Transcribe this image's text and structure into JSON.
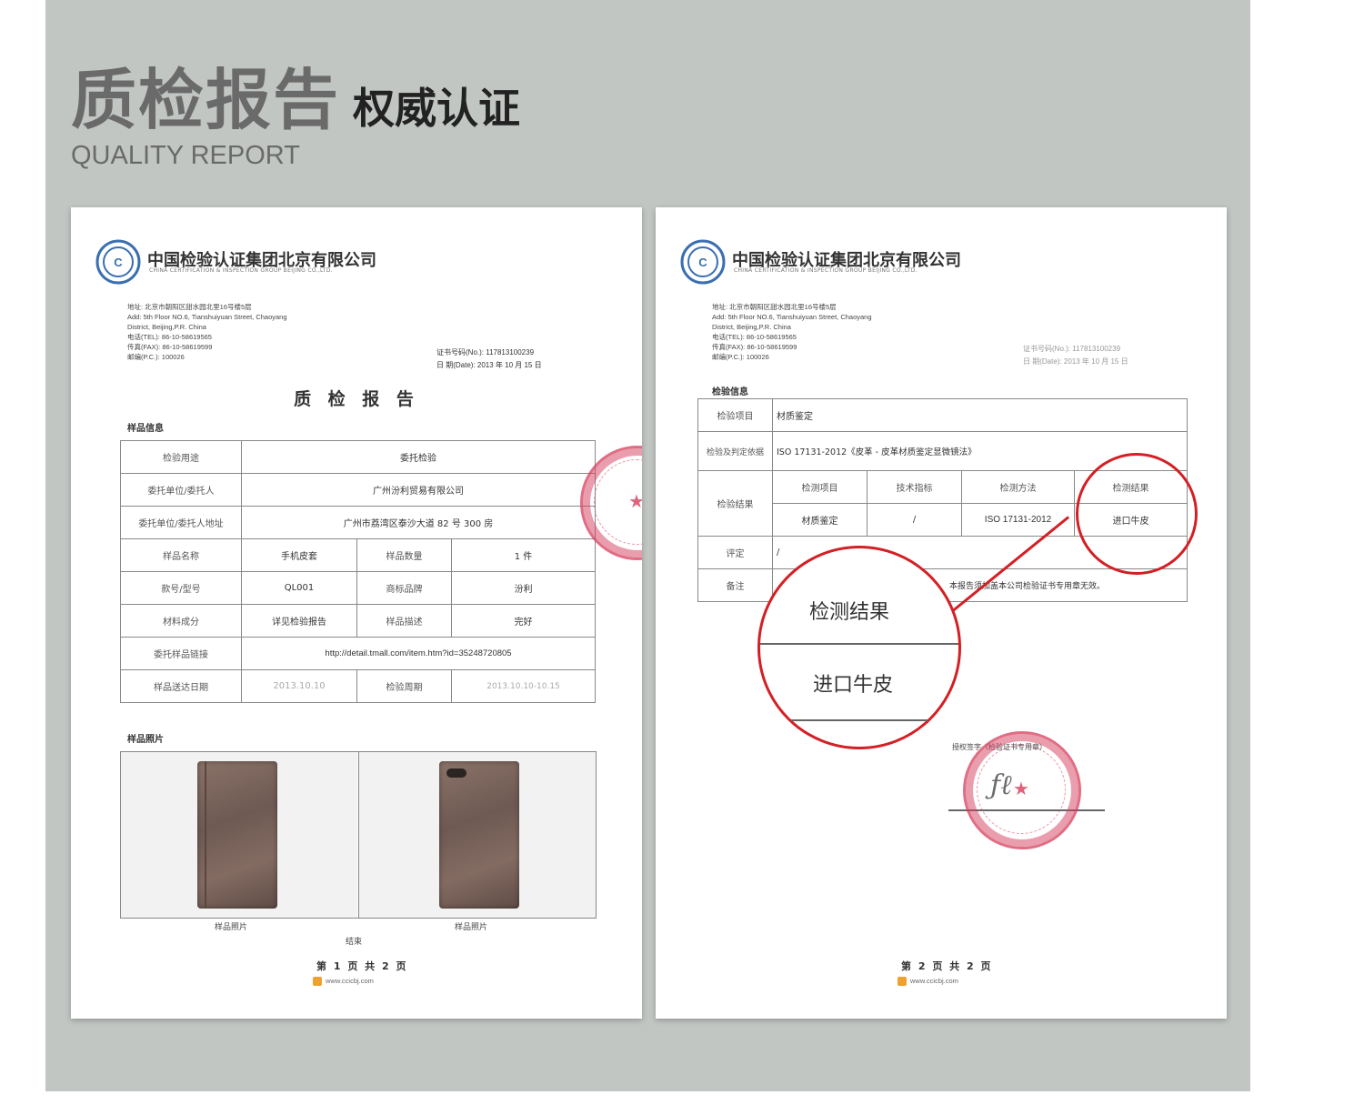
{
  "header": {
    "title_cn": "质检报告",
    "subtitle_cn": "权威认证",
    "title_en": "QUALITY REPORT"
  },
  "company": {
    "name_cn": "中国检验认证集团北京有限公司",
    "name_en": "CHINA CERTIFICATION & INSPECTION GROUP BEIJING CO.,LTD."
  },
  "address_block": {
    "line1": "地址: 北京市朝阳区甜水园北里16号楼5层",
    "line2": "Add:    5th Floor NO.6, Tianshuiyuan Street, Chaoyang",
    "line3": "           District, Beijing,P.R. China",
    "line4": "电话(TEL): 86-10-58619565",
    "line5": "传真(FAX): 86-10-58619599",
    "line6": "邮编(P.C.): 100026"
  },
  "page1": {
    "cert_no": "证书号码(No.): 117813100239",
    "date": "日    期(Date): 2013 年 10 月 15 日",
    "report_title": "质 检 报 告",
    "section_sample_info": "样品信息",
    "rows": [
      {
        "label": "检验用途",
        "value": "委托检验"
      },
      {
        "label": "委托单位/委托人",
        "value": "广州汾利贸易有限公司"
      },
      {
        "label": "委托单位/委托人地址",
        "value": "广州市荔湾区泰沙大道 82 号 300 房"
      }
    ],
    "rows4": [
      {
        "a": "样品名称",
        "b": "手机皮套",
        "c": "样品数量",
        "d": "1 件"
      },
      {
        "a": "款号/型号",
        "b": "QL001",
        "c": "商标品牌",
        "d": "汾利"
      },
      {
        "a": "材料成分",
        "b": "详见检验报告",
        "c": "样品描述",
        "d": "完好"
      }
    ],
    "link_row": {
      "label": "委托样品链接",
      "value": "http://detail.tmall.com/item.htm?id=35248720805"
    },
    "date_row": {
      "a": "样品送达日期",
      "b": "2013.10.10",
      "c": "检验周期",
      "d": "2013.10.10-10.15"
    },
    "section_photos": "样品照片",
    "photo_caption_left": "样品照片",
    "photo_caption_right": "样品照片",
    "end_mark": "结束",
    "page_no": "第 1 页 共 2 页",
    "url": "www.ccicbj.com"
  },
  "page2": {
    "cert_no": "证书号码(No.): 117813100239",
    "date": "日    期(Date): 2013 年 10 月 15 日",
    "section_test_info": "检验信息",
    "item_label": "检验项目",
    "item_value": "材质鉴定",
    "basis_label": "检验及判定依据",
    "basis_value": "ISO 17131-2012《皮革 - 皮革材质鉴定显微镜法》",
    "result_label": "检验结果",
    "result_headers": [
      "检测项目",
      "技术指标",
      "检测方法",
      "检测结果"
    ],
    "result_values": [
      "材质鉴定",
      "/",
      "ISO 17131-2012",
      "进口牛皮"
    ],
    "comment_label": "评定",
    "comment_value": "/",
    "remark_label": "备注",
    "remark_value": "本报告须加盖本公司检验证书专用章无效。",
    "zoom_result_label": "检测结果",
    "zoom_result_value": "进口牛皮",
    "sign_label": "授权签字（检验证书专用章）",
    "page_no": "第 2 页 共 2 页",
    "url": "www.ccicbj.com"
  },
  "colors": {
    "background_panel": "#c2c6c3",
    "highlight_red": "#d41f24",
    "stamp_red": "#d63c5a"
  }
}
